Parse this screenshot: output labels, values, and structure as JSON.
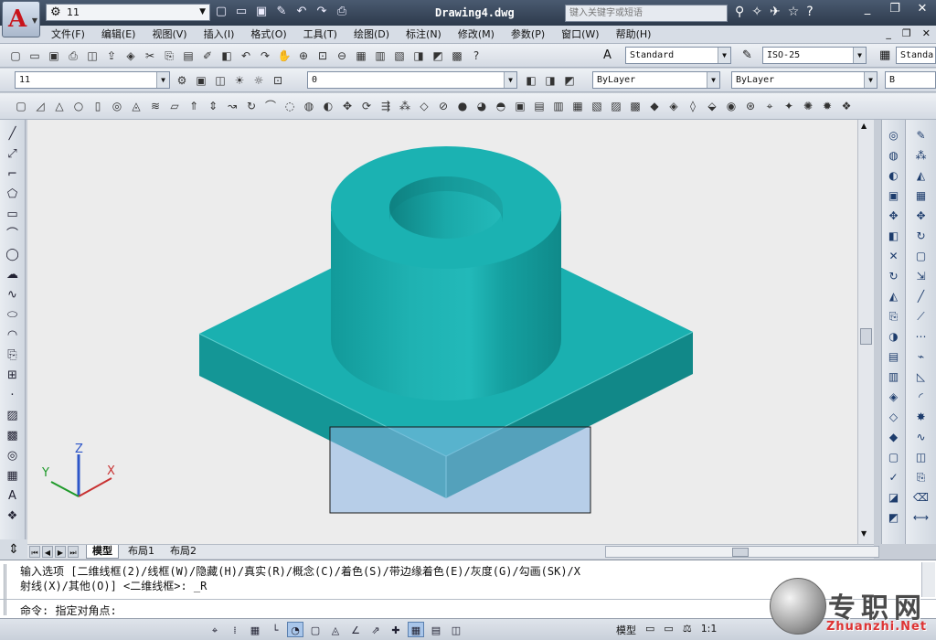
{
  "app": {
    "logo": "A",
    "document_title": "Drawing4.dwg",
    "workspace": "11",
    "help_search_placeholder": "键入关键字或短语"
  },
  "menu": [
    "文件(F)",
    "编辑(E)",
    "视图(V)",
    "插入(I)",
    "格式(O)",
    "工具(T)",
    "绘图(D)",
    "标注(N)",
    "修改(M)",
    "参数(P)",
    "窗口(W)",
    "帮助(H)"
  ],
  "toolbar": {
    "text_style": "Standard",
    "dim_style": "ISO-25",
    "table_style": "Standa",
    "workspace_combo": "11",
    "layer_combo": "0",
    "color_combo": "ByLayer",
    "linetype_combo": "ByLayer",
    "lineweight_combo": "B"
  },
  "layout_tabs": [
    "模型",
    "布局1",
    "布局2"
  ],
  "command": {
    "history_line1": "输入选项 [二维线框(2)/线框(W)/隐藏(H)/真实(R)/概念(C)/着色(S)/带边缘着色(E)/灰度(G)/勾画(SK)/X",
    "history_line2": "射线(X)/其他(O)] <二维线框>: _R",
    "prompt": "命令: 指定对角点:"
  },
  "status": {
    "space": "模型",
    "scale": "1:1"
  },
  "ucs": {
    "x": "X",
    "y": "Y",
    "z": "Z"
  },
  "watermark": {
    "text": "专职网",
    "url": "Zhuanzhi.Net"
  },
  "colors": {
    "model": "#1aa5a5",
    "selection": "#a9c9ec",
    "canvas": "#ececec"
  }
}
